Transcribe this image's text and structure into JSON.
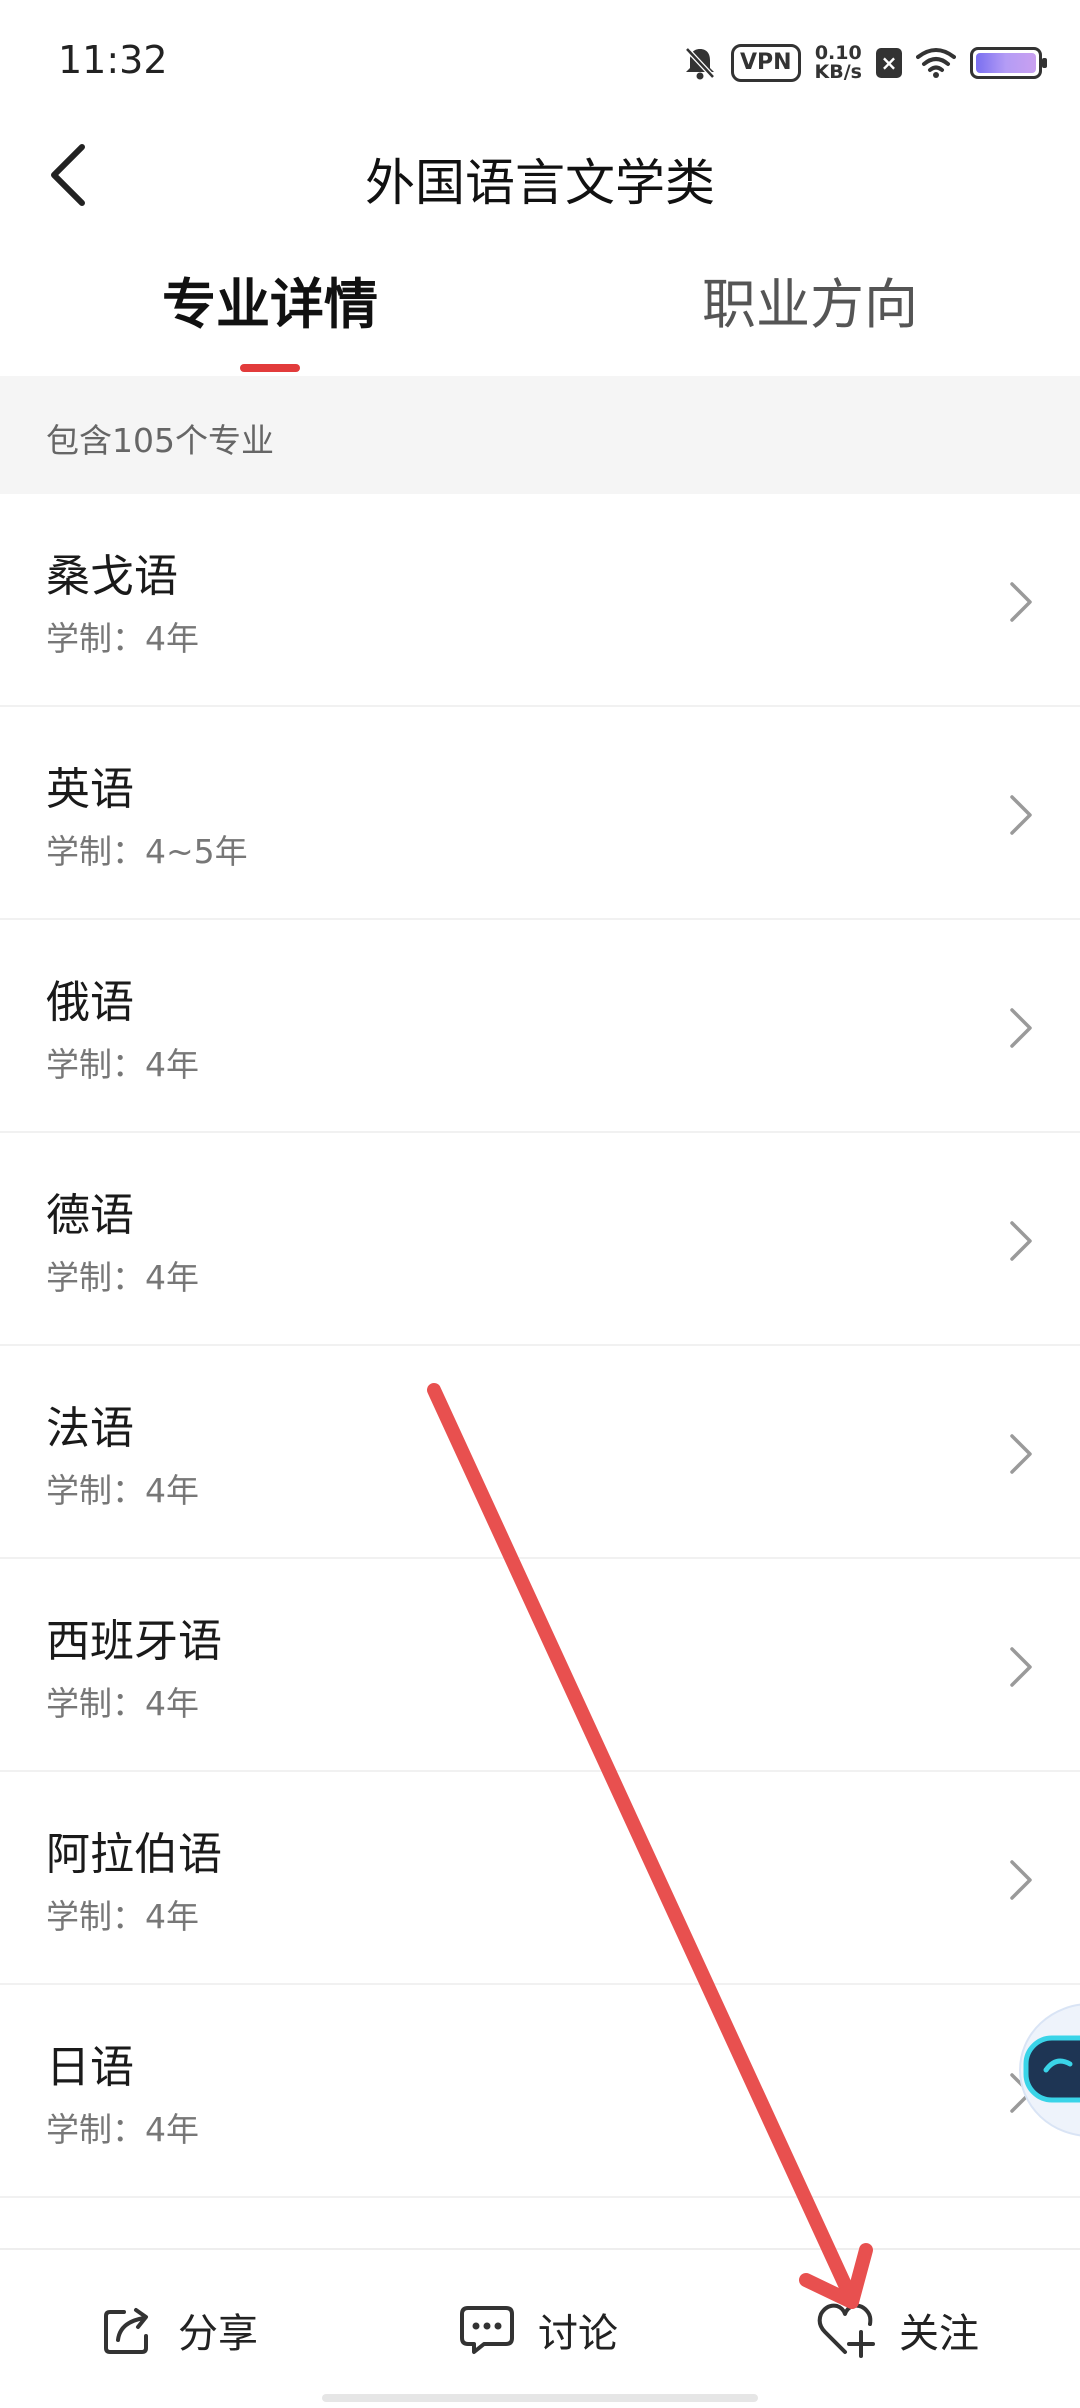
{
  "status_bar": {
    "time": "11:32",
    "vpn": "VPN",
    "speed_value": "0.10",
    "speed_unit": "KB/s",
    "icons": [
      "bell-off-icon",
      "vpn-icon",
      "x-icon",
      "wifi-icon",
      "battery-icon"
    ]
  },
  "header": {
    "title": "外国语言文学类",
    "back_icon": "chevron-left-icon"
  },
  "tabs": [
    {
      "label": "专业详情",
      "active": true
    },
    {
      "label": "职业方向",
      "active": false
    }
  ],
  "summary": {
    "text": "包含105个专业"
  },
  "majors": [
    {
      "name": "桑戈语",
      "years": "学制：4年"
    },
    {
      "name": "英语",
      "years": "学制：4~5年"
    },
    {
      "name": "俄语",
      "years": "学制：4年"
    },
    {
      "name": "德语",
      "years": "学制：4年"
    },
    {
      "name": "法语",
      "years": "学制：4年"
    },
    {
      "name": "西班牙语",
      "years": "学制：4年"
    },
    {
      "name": "阿拉伯语",
      "years": "学制：4年"
    },
    {
      "name": "日语",
      "years": "学制：4年"
    }
  ],
  "bottom_bar": {
    "share_label": "分享",
    "discuss_label": "讨论",
    "follow_label": "关注"
  },
  "colors": {
    "accent": "#e23b3b",
    "annotation_arrow": "#e8504f"
  }
}
